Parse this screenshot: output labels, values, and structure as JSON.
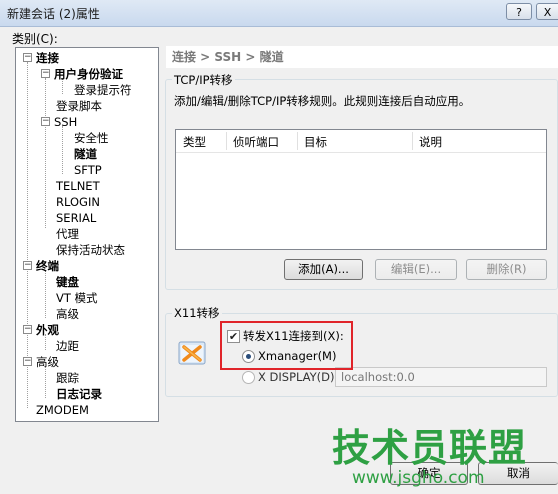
{
  "window": {
    "title": "新建会话 (2)属性",
    "help_label": "?",
    "close_label": "X"
  },
  "category_label": "类别(C):",
  "tree": {
    "nodes": [
      {
        "label": "连接",
        "bold": true,
        "expander": "−"
      },
      {
        "label": "用户身份验证",
        "bold": true,
        "expander": "−"
      },
      {
        "label": "登录提示符",
        "bold": false
      },
      {
        "label": "登录脚本",
        "bold": false
      },
      {
        "label": "SSH",
        "bold": false,
        "expander": "−"
      },
      {
        "label": "安全性",
        "bold": false
      },
      {
        "label": "隧道",
        "bold": true
      },
      {
        "label": "SFTP",
        "bold": false
      },
      {
        "label": "TELNET",
        "bold": false
      },
      {
        "label": "RLOGIN",
        "bold": false
      },
      {
        "label": "SERIAL",
        "bold": false
      },
      {
        "label": "代理",
        "bold": false
      },
      {
        "label": "保持活动状态",
        "bold": false
      },
      {
        "label": "终端",
        "bold": true,
        "expander": "−"
      },
      {
        "label": "键盘",
        "bold": true
      },
      {
        "label": "VT 模式",
        "bold": false
      },
      {
        "label": "高级",
        "bold": false
      },
      {
        "label": "外观",
        "bold": true,
        "expander": "−"
      },
      {
        "label": "边距",
        "bold": false
      },
      {
        "label": "高级",
        "bold": false,
        "expander": "−"
      },
      {
        "label": "跟踪",
        "bold": false
      },
      {
        "label": "日志记录",
        "bold": true
      },
      {
        "label": "ZMODEM",
        "bold": false
      }
    ]
  },
  "breadcrumb": "连接 > SSH > 隧道",
  "tcpip": {
    "title": "TCP/IP转移",
    "description": "添加/编辑/删除TCP/IP转移规则。此规则连接后自动应用。",
    "columns": [
      "类型",
      "侦听端口",
      "目标",
      "说明"
    ],
    "add_label": "添加(A)...",
    "edit_label": "编辑(E)...",
    "delete_label": "删除(R)"
  },
  "x11": {
    "title": "X11转移",
    "forward_label": "转发X11连接到(X):",
    "forward_checked": true,
    "xmanager_label": "Xmanager(M)",
    "xdisplay_label": "X DISPLAY(D):",
    "xdisplay_value": "localhost:0.0"
  },
  "watermark": {
    "text": "技术员联盟",
    "sub": "www.jsgho.com"
  },
  "buttons": {
    "ok_label": "确定",
    "cancel_label": "取消"
  },
  "colors": {
    "highlight_border": "#e0242a",
    "watermark": "#2ea043"
  }
}
